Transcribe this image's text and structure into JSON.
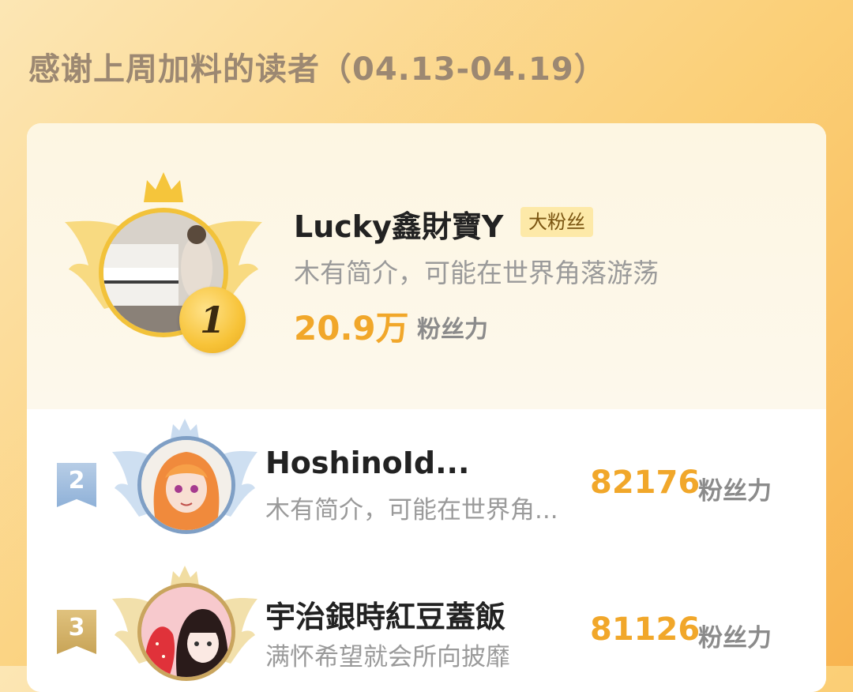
{
  "header": {
    "title": "感谢上周加料的读者（04.13-04.19）"
  },
  "top": {
    "rank": "1",
    "name": "Lucky鑫財寶Y",
    "badge": "大粉丝",
    "intro": "木有简介，可能在世界角落游荡",
    "score": "20.9万",
    "score_label": "粉丝力"
  },
  "rows": [
    {
      "rank": "2",
      "name": "HoshinoId...",
      "intro": "木有简介，可能在世界角...",
      "score": "82176",
      "score_label": "粉丝力"
    },
    {
      "rank": "3",
      "name": "宇治銀時紅豆蓋飯",
      "intro": "满怀希望就会所向披靡",
      "score": "81126",
      "score_label": "粉丝力"
    }
  ],
  "colors": {
    "gold": "#f2c23a",
    "score": "#f1a72a",
    "silver_rank": "#8fb1d8",
    "bronze_rank": "#c8a457"
  },
  "icons": [
    "crown-icon",
    "wing-left-icon",
    "wing-right-icon",
    "rank-flag-icon"
  ]
}
